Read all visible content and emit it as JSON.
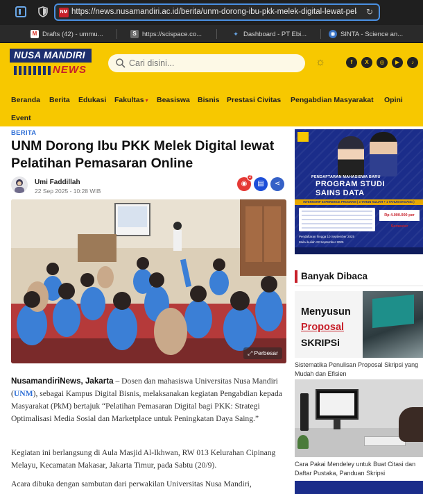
{
  "browser": {
    "url": "https://news.nusamandiri.ac.id/berita/unm-dorong-ibu-pkk-melek-digital-lewat-pelatih",
    "tabs": [
      {
        "label": "Drafts (42) - ummu...",
        "favicon": "gmail-icon"
      },
      {
        "label": "https://scispace.co...",
        "favicon": "scispace-icon"
      },
      {
        "label": "Dashboard - PT Ebi...",
        "favicon": "dashboard-icon"
      },
      {
        "label": "SINTA - Science an...",
        "favicon": "sinta-icon"
      }
    ]
  },
  "site": {
    "logo_top": "NUSA MANDIRI",
    "logo_bottom": "NEWS",
    "search_placeholder": "Cari disini...",
    "social": [
      "f",
      "X",
      "◎",
      "▶",
      "♪"
    ],
    "nav": [
      {
        "label": "Beranda"
      },
      {
        "label": "Berita"
      },
      {
        "label": "Edukasi"
      },
      {
        "label": "Fakultas"
      },
      {
        "label": "Beasiswa"
      },
      {
        "label": "Bisnis"
      },
      {
        "label": "Prestasi Civitas"
      },
      {
        "label": "Pengabdian Masyarakat"
      },
      {
        "label": "Opini"
      },
      {
        "label": "Event"
      }
    ],
    "brand_yellow": "#f7c800",
    "brand_navy": "#1d2f6f",
    "brand_red": "#c7202a"
  },
  "article": {
    "category": "BERITA",
    "title": "UNM Dorong Ibu PKK Melek Digital lewat Pelatihan Pemasaran Online",
    "author": "Umi Faddillah",
    "date": "22 Sep 2025 - 10:28 WIB",
    "view_badge": "2",
    "zoom_label": "Perbesar",
    "p1_lead": "NusamandiriNews, Jakarta",
    "p1_a": " – Dosen dan mahasiswa Universitas Nusa Mandiri (",
    "p1_link": "UNM",
    "p1_b": "), sebagai Kampus Digital Bisnis, melaksanakan kegiatan Pengabdian kepada Masyarakat (PkM) bertajuk “Pelatihan Pemasaran Digital bagi PKK: Strategi Optimalisasi Media Sosial dan Marketplace untuk Peningkatan Daya Saing.”",
    "p2": "Kegiatan ini berlangsung di Aula Masjid Al-Ikhwan, RW 013 Kelurahan Cipinang Melayu, Kecamatan Makasar, Jakarta Timur, pada Sabtu (20/9).",
    "p3": "Acara dibuka dengan sambutan dari perwakilan Universitas Nusa Mandiri,"
  },
  "sidebar": {
    "ad": {
      "pill": "PENDAFTARAN MAHASISWA BARU",
      "line1": "PROGRAM STUDI",
      "line2": "SAINS DATA",
      "strip": "INTERNSHIP EXPERIENCE PROGRAM ( 3 TAHUN KULIAH + 1 TAHUN MAGANG )",
      "price": "Rp 4.000.000 per Semester",
      "note1": "Pendaftaran hingga 10 September 2025",
      "note2": "Mulai kuliah 22 September 2025"
    },
    "section_title": "Banyak Dibaca",
    "card1": {
      "line1": "Menyusun",
      "line2": "Proposal",
      "line3": "SKRIPSi",
      "caption": "Sistematika Penulisan Proposal Skripsi yang Mudah dan Efisien"
    },
    "card2": {
      "caption": "Cara Pakai Mendeley untuk Buat Citasi dan Daftar Pustaka, Panduan Skripsi"
    }
  }
}
